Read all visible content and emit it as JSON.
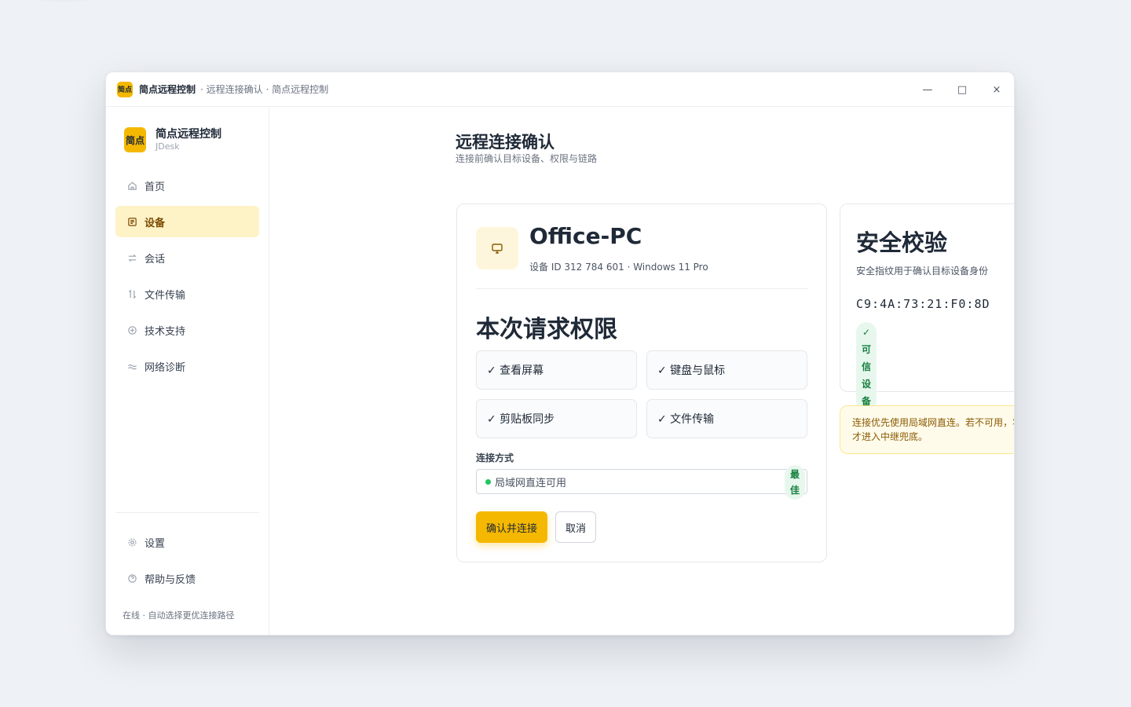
{
  "titlebar": {
    "logo": "简点",
    "app_name": "简点远程控制",
    "subtitle": "· 远程连接确认 · 简点远程控制",
    "minimize": "—",
    "maximize": "□",
    "close": "×"
  },
  "sidebar": {
    "logo": "简点",
    "brand_name": "简点远程控制",
    "brand_sub": "JDesk",
    "items": [
      {
        "label": "首页",
        "icon": "home-icon"
      },
      {
        "label": "设备",
        "icon": "list-icon",
        "active": true
      },
      {
        "label": "会话",
        "icon": "swap-icon"
      },
      {
        "label": "文件传输",
        "icon": "transfer-icon"
      },
      {
        "label": "技术支持",
        "icon": "plus-circle-icon"
      },
      {
        "label": "网络诊断",
        "icon": "wave-icon"
      }
    ],
    "bottom_items": [
      {
        "label": "设置",
        "icon": "gear-icon"
      },
      {
        "label": "帮助与反馈",
        "icon": "help-icon"
      }
    ],
    "status": "在线 · 自动选择更优连接路径"
  },
  "main": {
    "title": "远程连接确认",
    "subtitle": "连接前确认目标设备、权限与链路",
    "device": {
      "name": "Office-PC",
      "meta": "设备 ID 312 784 601 · Windows 11 Pro"
    },
    "permissions_title": "本次请求权限",
    "permissions": [
      "✓ 查看屏幕",
      "✓ 键盘与鼠标",
      "✓ 剪贴板同步",
      "✓ 文件传输"
    ],
    "connection": {
      "label": "连接方式",
      "value": "局域网直连可用",
      "badge_1": "最",
      "badge_2": "佳"
    },
    "confirm_button": "确认并连接",
    "cancel_button": "取消",
    "security": {
      "title": "安全校验",
      "subtitle": "安全指纹用于确认目标设备身份",
      "fingerprint": "C9:4A:73:21:F0:8D",
      "trusted_chars": [
        "✓",
        "可",
        "信",
        "设",
        "备"
      ]
    },
    "notice": {
      "line1": "连接优先使用局域网直连。若不可用，将",
      "line2": "才进入中继兜底。"
    }
  },
  "colors": {
    "accent": "#f5b800",
    "active_bg": "#fef3c7",
    "success": "#15803d"
  }
}
